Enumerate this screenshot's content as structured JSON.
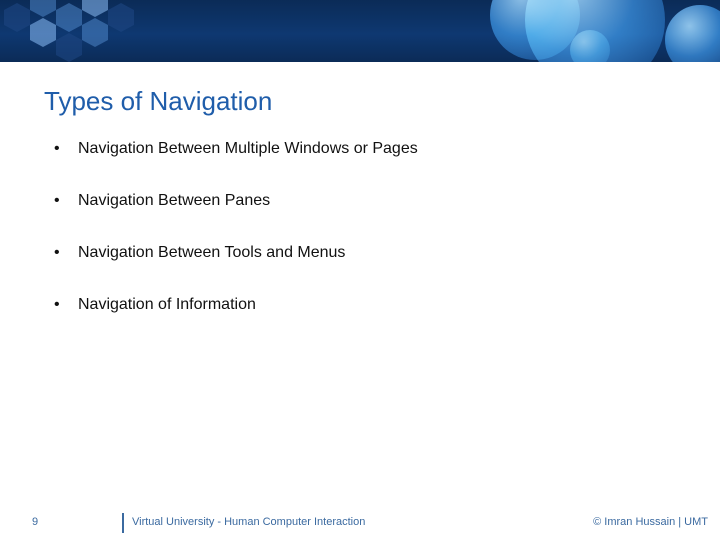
{
  "title": "Types of Navigation",
  "bullets": [
    "Navigation Between Multiple Windows or Pages",
    "Navigation Between Panes",
    "Navigation Between Tools and Menus",
    "Navigation of Information"
  ],
  "footer": {
    "page": "9",
    "center": "Virtual University - Human Computer Interaction",
    "right": "© Imran Hussain | UMT"
  }
}
